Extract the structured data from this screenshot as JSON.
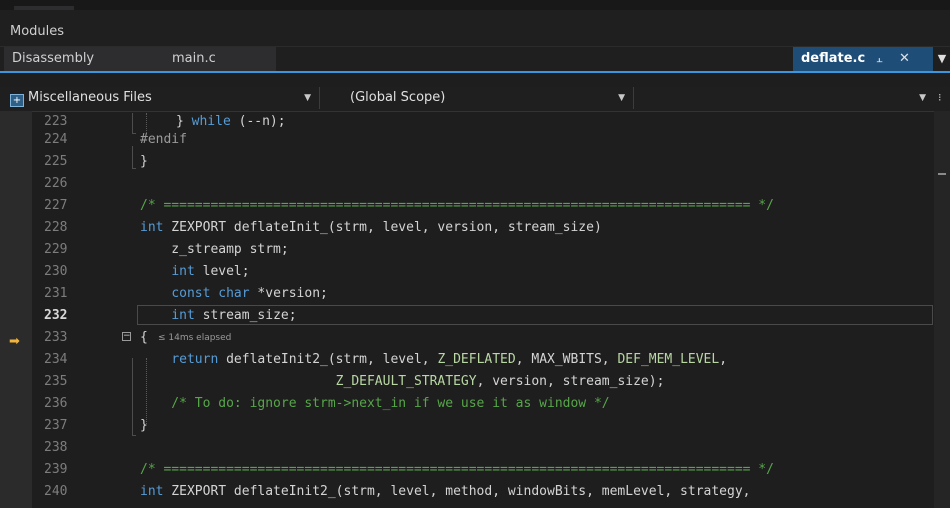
{
  "panel_title": "Modules",
  "tabs": [
    {
      "label": "Disassembly"
    },
    {
      "label": "main.c"
    }
  ],
  "active_tab": {
    "label": "deflate.c",
    "pin_icon": "pin-icon",
    "close_icon": "close-icon"
  },
  "tab_menu_icon": "chevron-down-icon",
  "nav": {
    "project": "Miscellaneous Files",
    "scope": "(Global Scope)",
    "member": ""
  },
  "editor": {
    "current_line": "232",
    "execution_line": "233",
    "perf_tip": "≤ 14ms elapsed",
    "lines": [
      {
        "num": "223",
        "code": "} while (--n);"
      },
      {
        "num": "224",
        "code": "#endif"
      },
      {
        "num": "225",
        "code": "}"
      },
      {
        "num": "226",
        "code": ""
      },
      {
        "num": "227",
        "code": "/* =========================================================================== */"
      },
      {
        "num": "228",
        "code": "int ZEXPORT deflateInit_(strm, level, version, stream_size)"
      },
      {
        "num": "229",
        "code": "    z_streamp strm;"
      },
      {
        "num": "230",
        "code": "    int level;"
      },
      {
        "num": "231",
        "code": "    const char *version;"
      },
      {
        "num": "232",
        "code": "    int stream_size;"
      },
      {
        "num": "233",
        "code": "{"
      },
      {
        "num": "234",
        "code": "    return deflateInit2_(strm, level, Z_DEFLATED, MAX_WBITS, DEF_MEM_LEVEL,"
      },
      {
        "num": "235",
        "code": "                         Z_DEFAULT_STRATEGY, version, stream_size);"
      },
      {
        "num": "236",
        "code": "    /* To do: ignore strm->next_in if we use it as window */"
      },
      {
        "num": "237",
        "code": "}"
      },
      {
        "num": "238",
        "code": ""
      },
      {
        "num": "239",
        "code": "/* =========================================================================== */"
      },
      {
        "num": "240",
        "code": "int ZEXPORT deflateInit2_(strm, level, method, windowBits, memLevel, strategy,"
      }
    ]
  }
}
